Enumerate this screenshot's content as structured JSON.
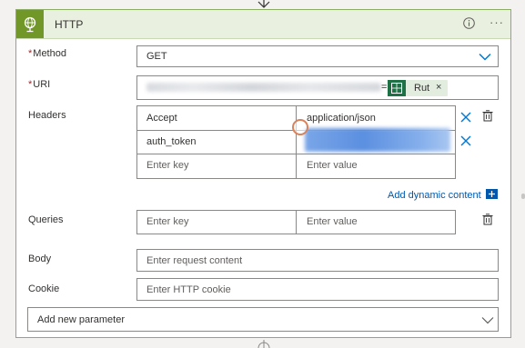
{
  "action": {
    "title": "HTTP",
    "info_icon": "info-icon",
    "more_icon": "more-options-icon",
    "brand_color": "#709727",
    "header_bg": "#e9f0df"
  },
  "method": {
    "label": "Method",
    "required": "*",
    "value": "GET"
  },
  "uri": {
    "label": "URI",
    "required": "*",
    "token": {
      "label": "Rut",
      "remove": "×",
      "icon": "excel-icon"
    }
  },
  "headers": {
    "label": "Headers",
    "rows": [
      {
        "key": "Accept",
        "value": "application/json"
      },
      {
        "key": "auth_token",
        "value": ""
      }
    ],
    "key_placeholder": "Enter key",
    "value_placeholder": "Enter value"
  },
  "dynamic_content": {
    "label": "Add dynamic content",
    "icon": "plus-icon",
    "link_color": "#0058ad"
  },
  "queries": {
    "label": "Queries",
    "key_placeholder": "Enter key",
    "value_placeholder": "Enter value"
  },
  "body": {
    "label": "Body",
    "placeholder": "Enter request content"
  },
  "cookie": {
    "label": "Cookie",
    "placeholder": "Enter HTTP cookie"
  },
  "add_parameter": {
    "label": "Add new parameter"
  }
}
